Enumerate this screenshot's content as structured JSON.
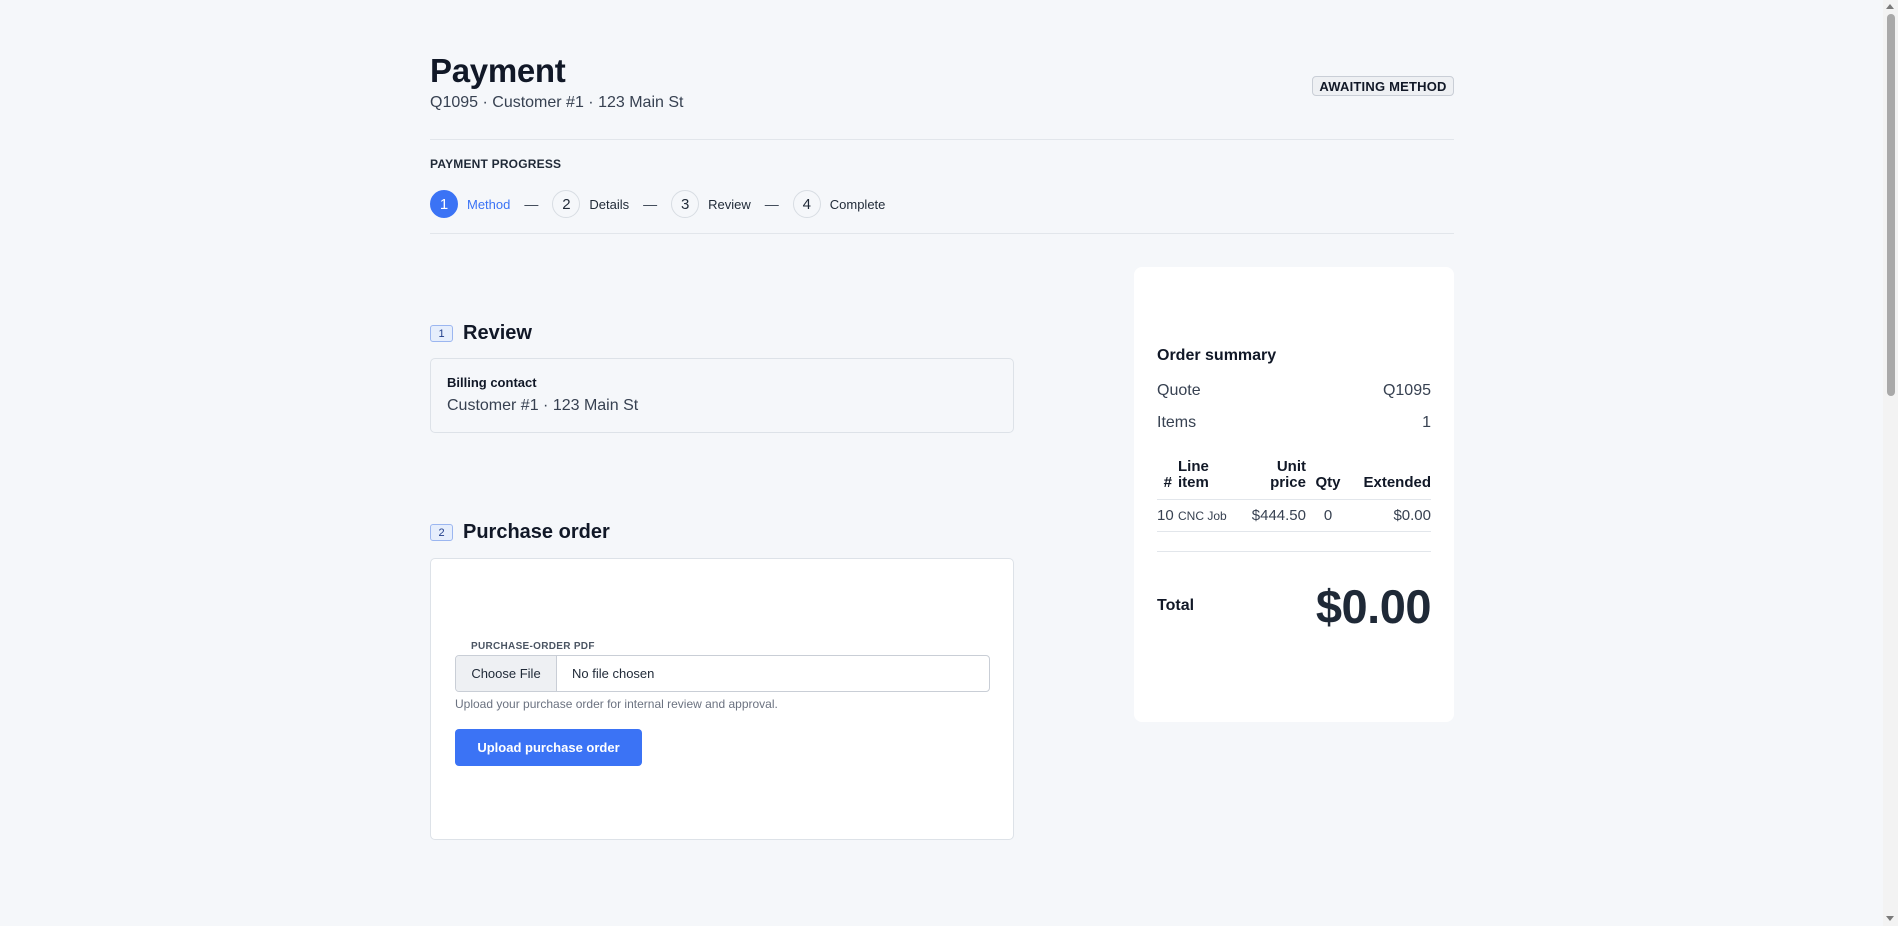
{
  "header": {
    "title": "Payment",
    "subtitle": "Q1095 · Customer #1 · 123 Main St",
    "status": "AWAITING METHOD"
  },
  "progress": {
    "label": "PAYMENT PROGRESS",
    "separator": "—",
    "steps": [
      {
        "num": "1",
        "label": "Method",
        "active": true
      },
      {
        "num": "2",
        "label": "Details",
        "active": false
      },
      {
        "num": "3",
        "label": "Review",
        "active": false
      },
      {
        "num": "4",
        "label": "Complete",
        "active": false
      }
    ]
  },
  "review": {
    "num": "1",
    "title": "Review",
    "billing_label": "Billing contact",
    "billing_value": "Customer #1 · 123 Main St"
  },
  "purchase_order": {
    "num": "2",
    "title": "Purchase order",
    "field_label": "PURCHASE-ORDER PDF",
    "choose_file": "Choose File",
    "no_file": "No file chosen",
    "help": "Upload your purchase order for internal review and approval.",
    "upload_button": "Upload purchase order"
  },
  "summary": {
    "title": "Order summary",
    "quote_label": "Quote",
    "quote_value": "Q1095",
    "items_label": "Items",
    "items_value": "1",
    "columns": [
      "#",
      "Line item",
      "Unit price",
      "Qty",
      "Extended"
    ],
    "rows": [
      {
        "num": "10",
        "item": "CNC Job",
        "unit_price": "$444.50",
        "qty": "0",
        "extended": "$0.00"
      }
    ],
    "total_label": "Total",
    "total_value": "$0.00"
  },
  "colors": {
    "accent": "#3b73f5",
    "background": "#f5f7fa"
  }
}
